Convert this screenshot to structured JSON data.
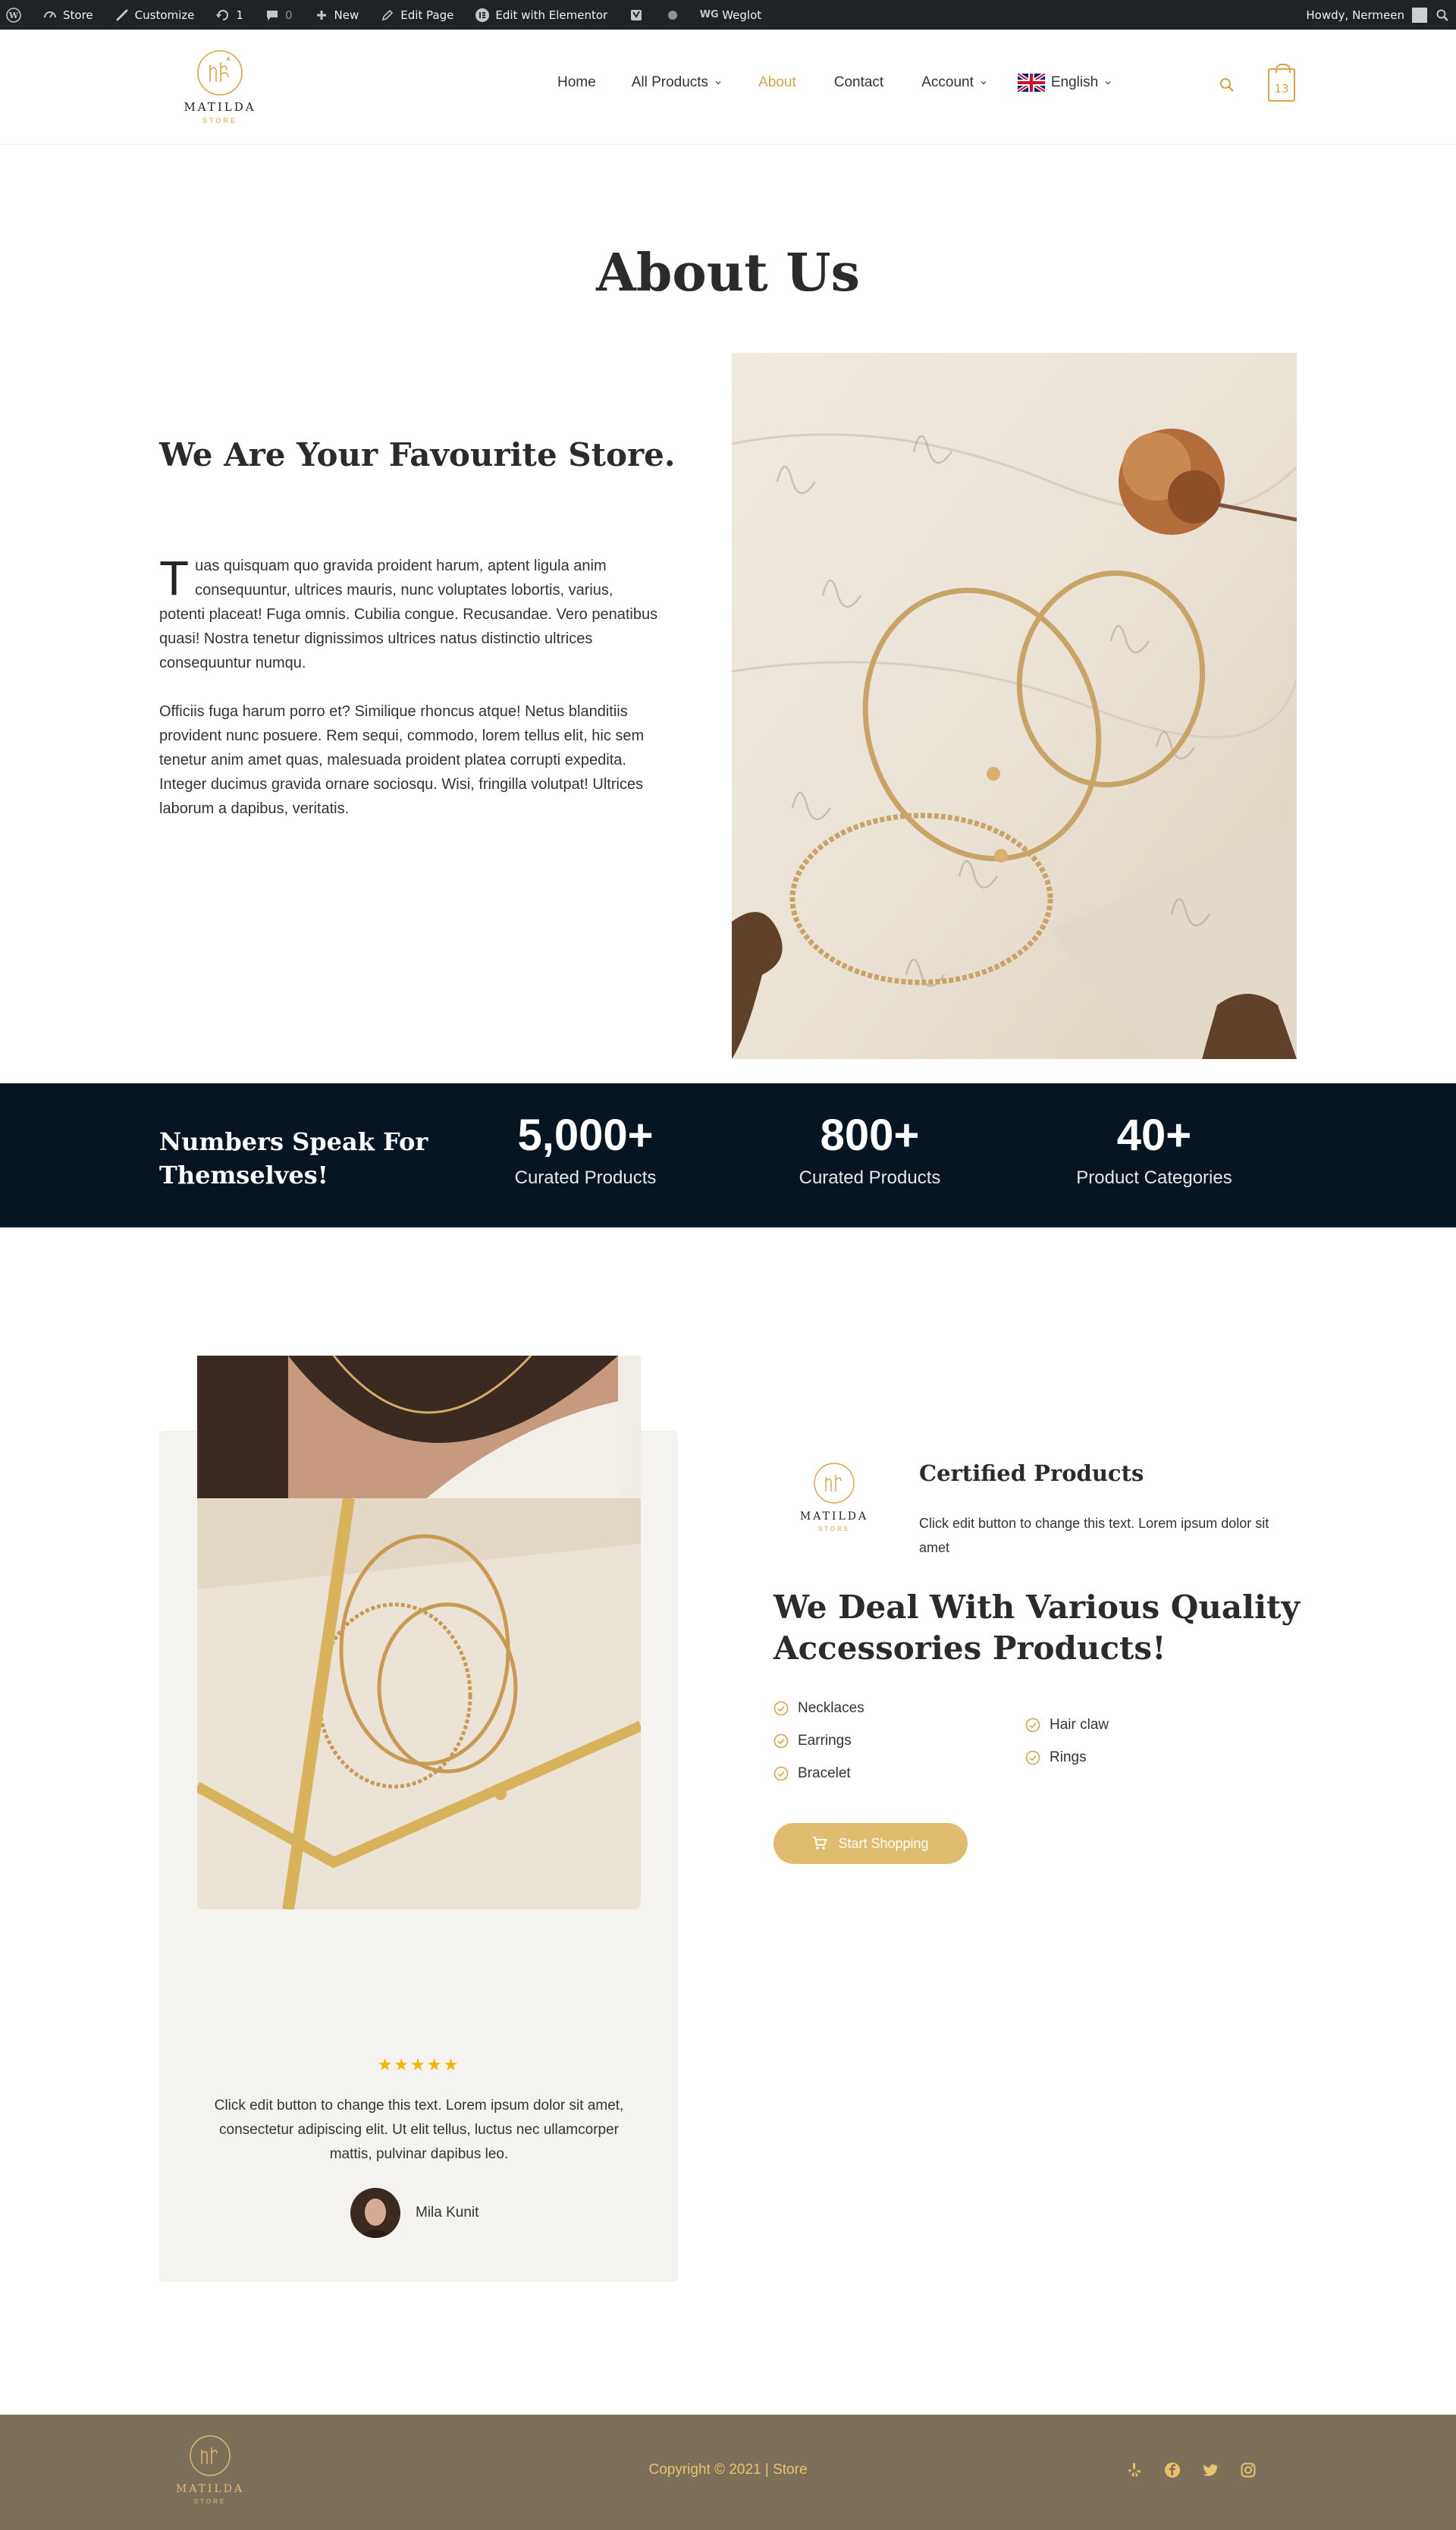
{
  "adminbar": {
    "site": "Store",
    "customize": "Customize",
    "updates": "1",
    "comments": "0",
    "new": "New",
    "edit_page": "Edit Page",
    "elementor": "Edit with Elementor",
    "weglot": "Weglot",
    "howdy": "Howdy, Nermeen"
  },
  "header": {
    "logo_name": "MATILDA",
    "logo_sub": "STORE",
    "nav": {
      "home": "Home",
      "products": "All Products",
      "about": "About",
      "contact": "Contact",
      "account": "Account",
      "language": "English"
    },
    "cart_count": "13"
  },
  "about": {
    "title": "About Us",
    "subtitle": "We Are Your Favourite Store.",
    "dropcap": "T",
    "para1": "uas quisquam quo gravida proident harum, aptent ligula anim consequuntur, ultrices mauris, nunc voluptates lobortis, varius, potenti placeat! Fuga omnis. Cubilia congue. Recusandae. Vero penatibus quasi! Nostra tenetur dignissimos ultrices natus distinctio ultrices consequuntur numqu.",
    "para2": "Officiis fuga harum porro et? Similique rhoncus atque! Netus blanditiis provident nunc posuere. Rem sequi, commodo, lorem tellus elit, hic sem tenetur anim amet quas, malesuada proident platea corrupti expedita.",
    "para3": "Integer ducimus gravida ornare sociosqu. Wisi, fringilla volutpat! Ultrices laborum a dapibus, veritatis."
  },
  "stats": {
    "title": "Numbers Speak For Themselves!",
    "items": [
      {
        "value": "5,000+",
        "label": "Curated Products"
      },
      {
        "value": "800+",
        "label": "Curated Products"
      },
      {
        "value": "40+",
        "label": "Product Categories"
      }
    ]
  },
  "testimonial": {
    "rating": 5,
    "stars": "★★★★★",
    "quote": "Click edit button to change this text. Lorem ipsum dolor sit amet, consectetur adipiscing elit. Ut elit tellus, luctus nec ullamcorper mattis, pulvinar dapibus leo.",
    "author": "Mila Kunit"
  },
  "feature": {
    "cert_title": "Certified Products",
    "cert_text": "Click edit button to change this text. Lorem ipsum dolor sit amet",
    "deal_title": "We Deal With Various Quality Accessories Products!",
    "list_left": [
      "Necklaces",
      "Earrings",
      "Bracelet"
    ],
    "list_right": [
      "Hair claw",
      "Rings"
    ],
    "button": "Start Shopping"
  },
  "footer": {
    "copyright": "Copyright © 2021 | Store"
  },
  "colors": {
    "accent": "#d9a441",
    "dark_band": "#061521",
    "footer_bg": "#7c705b",
    "button": "#e0bd6e"
  }
}
